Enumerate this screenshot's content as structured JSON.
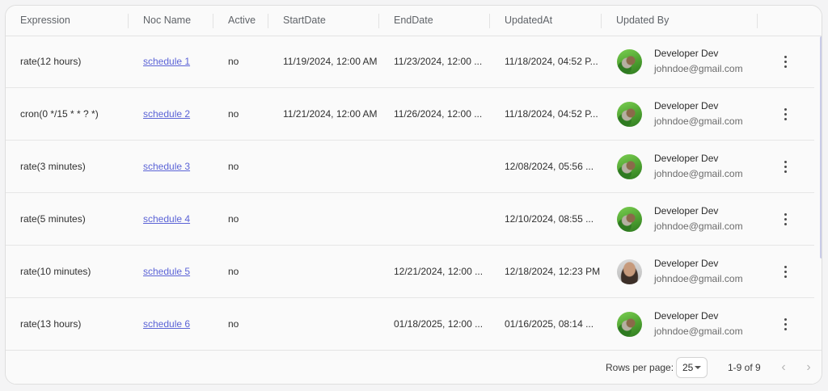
{
  "columns": {
    "expression": "Expression",
    "noc_name": "Noc Name",
    "active": "Active",
    "start_date": "StartDate",
    "end_date": "EndDate",
    "updated_at": "UpdatedAt",
    "updated_by": "Updated By"
  },
  "rows": [
    {
      "expression": "rate(12 hours)",
      "noc_name": "schedule 1",
      "active": "no",
      "start_date": "11/19/2024, 12:00 AM",
      "end_date": "11/23/2024, 12:00 ...",
      "updated_at": "11/18/2024, 04:52 P...",
      "user_name": "Developer Dev",
      "user_email": "johndoe@gmail.com",
      "avatar": "grass"
    },
    {
      "expression": "cron(0 */15 * * ? *)",
      "noc_name": "schedule 2",
      "active": "no",
      "start_date": "11/21/2024, 12:00 AM",
      "end_date": "11/26/2024, 12:00 ...",
      "updated_at": "11/18/2024, 04:52 P...",
      "user_name": "Developer Dev",
      "user_email": "johndoe@gmail.com",
      "avatar": "grass"
    },
    {
      "expression": "rate(3 minutes)",
      "noc_name": "schedule 3",
      "active": "no",
      "start_date": "",
      "end_date": "",
      "updated_at": "12/08/2024, 05:56 ...",
      "user_name": "Developer Dev",
      "user_email": "johndoe@gmail.com",
      "avatar": "grass"
    },
    {
      "expression": "rate(5 minutes)",
      "noc_name": "schedule 4",
      "active": "no",
      "start_date": "",
      "end_date": "",
      "updated_at": "12/10/2024, 08:55 ...",
      "user_name": "Developer Dev",
      "user_email": "johndoe@gmail.com",
      "avatar": "grass"
    },
    {
      "expression": "rate(10 minutes)",
      "noc_name": "schedule 5",
      "active": "no",
      "start_date": "",
      "end_date": "12/21/2024, 12:00 ...",
      "updated_at": "12/18/2024, 12:23 PM",
      "user_name": "Developer Dev",
      "user_email": "johndoe@gmail.com",
      "avatar": "face"
    },
    {
      "expression": "rate(13 hours)",
      "noc_name": "schedule 6",
      "active": "no",
      "start_date": "",
      "end_date": "01/18/2025, 12:00 ...",
      "updated_at": "01/16/2025, 08:14 ...",
      "user_name": "Developer Dev",
      "user_email": "johndoe@gmail.com",
      "avatar": "grass"
    }
  ],
  "footer": {
    "rows_per_page_label": "Rows per page:",
    "rows_per_page_value": "25",
    "range": "1-9 of 9",
    "prev_icon": "chevron-left-icon",
    "next_icon": "chevron-right-icon"
  },
  "colors": {
    "link": "#5b63d6",
    "scrollbar": "#c9cbe8"
  }
}
